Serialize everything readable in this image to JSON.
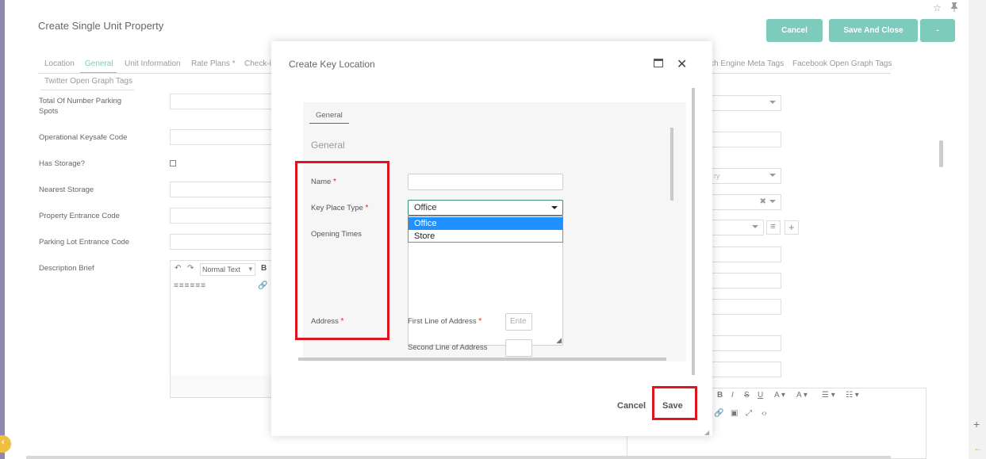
{
  "page": {
    "title": "Create Single Unit Property",
    "cancel_label": "Cancel",
    "save_close_label": "Save And Close",
    "more_label": "-"
  },
  "tabs": [
    "Location",
    "General",
    "Unit Information",
    "Rate Plans *",
    "Check-i",
    "ch Engine Meta Tags",
    "Facebook Open Graph Tags",
    "Twitter Open Graph Tags"
  ],
  "fields": {
    "parking_spots": "Total Of Number Parking Spots",
    "keysafe": "Operational Keysafe Code",
    "has_storage": "Has Storage?",
    "nearest_storage": "Nearest Storage",
    "entrance_code": "Property Entrance Code",
    "parking_code": "Parking Lot Entrance Code",
    "description_brief": "Description Brief"
  },
  "editor": {
    "format_label": "Normal Text",
    "bold": "B"
  },
  "right_select_fragment": "ry",
  "modal": {
    "title": "Create Key Location",
    "inner_tab": "General",
    "section_title": "General",
    "name_label": "Name",
    "key_place_type_label": "Key Place Type",
    "key_place_type_value": "Office",
    "options": [
      "Office",
      "Store"
    ],
    "opening_times_label": "Opening Times",
    "address_label": "Address",
    "first_line_label": "First Line of Address",
    "first_line_placeholder": "Ente",
    "second_line_label": "Second Line of Address",
    "required_mark": "*",
    "cancel_label": "Cancel",
    "save_label": "Save"
  },
  "colors": {
    "accent": "#7ccbbd",
    "highlight": "#e0141e",
    "selected_option": "#1e90ff"
  }
}
